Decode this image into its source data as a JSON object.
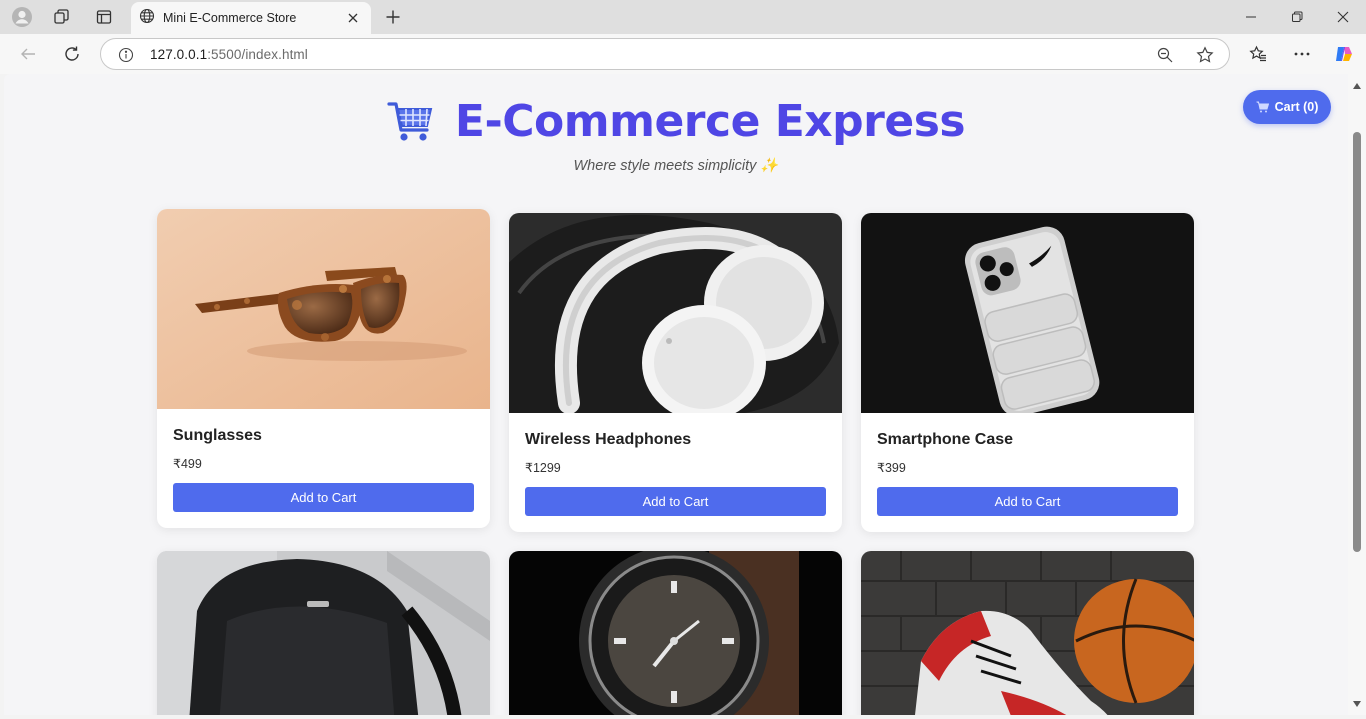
{
  "browser": {
    "tab_title": "Mini E-Commerce Store",
    "url_host": "127.0.0.1",
    "url_path": ":5500/index.html"
  },
  "header": {
    "title": "E-Commerce Express",
    "tagline": "Where style meets simplicity ✨",
    "cart_label": "Cart (0)"
  },
  "products": [
    {
      "name": "Sunglasses",
      "price": "₹499",
      "button": "Add to Cart"
    },
    {
      "name": "Wireless Headphones",
      "price": "₹1299",
      "button": "Add to Cart"
    },
    {
      "name": "Smartphone Case",
      "price": "₹399",
      "button": "Add to Cart"
    }
  ],
  "colors": {
    "accent": "#4f6bed",
    "title": "#4f46e5"
  }
}
